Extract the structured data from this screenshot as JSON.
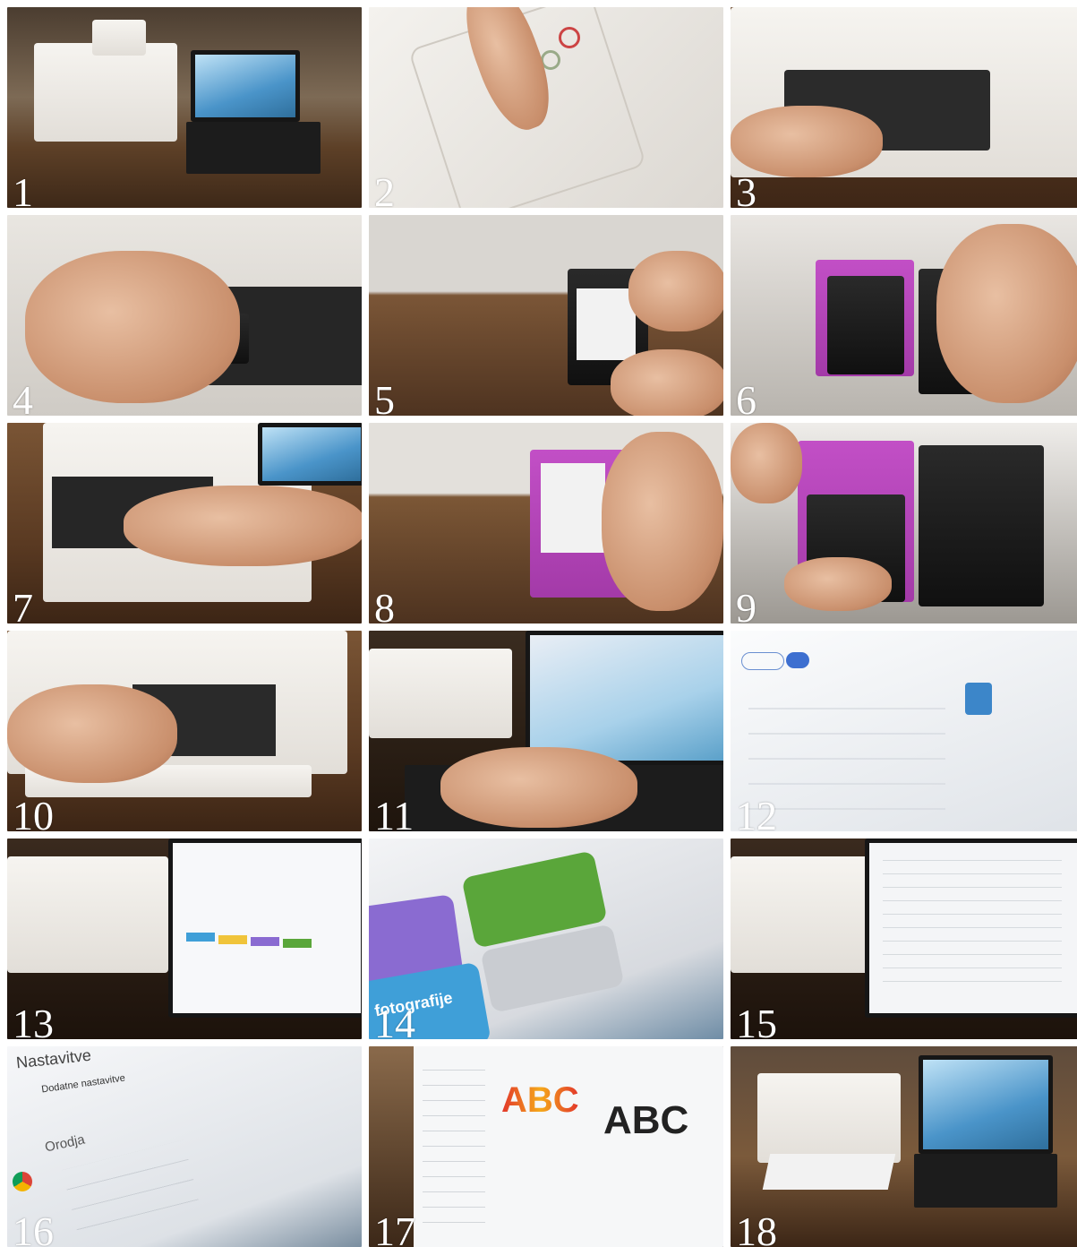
{
  "steps": [
    {
      "number": "1"
    },
    {
      "number": "2"
    },
    {
      "number": "3"
    },
    {
      "number": "4"
    },
    {
      "number": "5"
    },
    {
      "number": "6"
    },
    {
      "number": "7"
    },
    {
      "number": "8"
    },
    {
      "number": "9"
    },
    {
      "number": "10"
    },
    {
      "number": "11"
    },
    {
      "number": "12"
    },
    {
      "number": "13"
    },
    {
      "number": "14"
    },
    {
      "number": "15"
    },
    {
      "number": "16"
    },
    {
      "number": "17"
    },
    {
      "number": "18"
    }
  ],
  "screen_text": {
    "tile14_banner": "fotografije",
    "tile16_heading": "Nastavitve",
    "tile16_item1": "Dodatne nastavitve",
    "tile16_section": "Orodja",
    "tile17_abc_color": "ABC",
    "tile17_abc_black": "ABC"
  },
  "colors": {
    "wood": "#6b4a2f",
    "printer_white": "#f2efea",
    "laptop_black": "#161616",
    "cartridge_magenta": "#b444b8",
    "green_tile": "#5aa63a",
    "purple_tile": "#8a6bd1",
    "blue_tile": "#3f9fd8"
  }
}
